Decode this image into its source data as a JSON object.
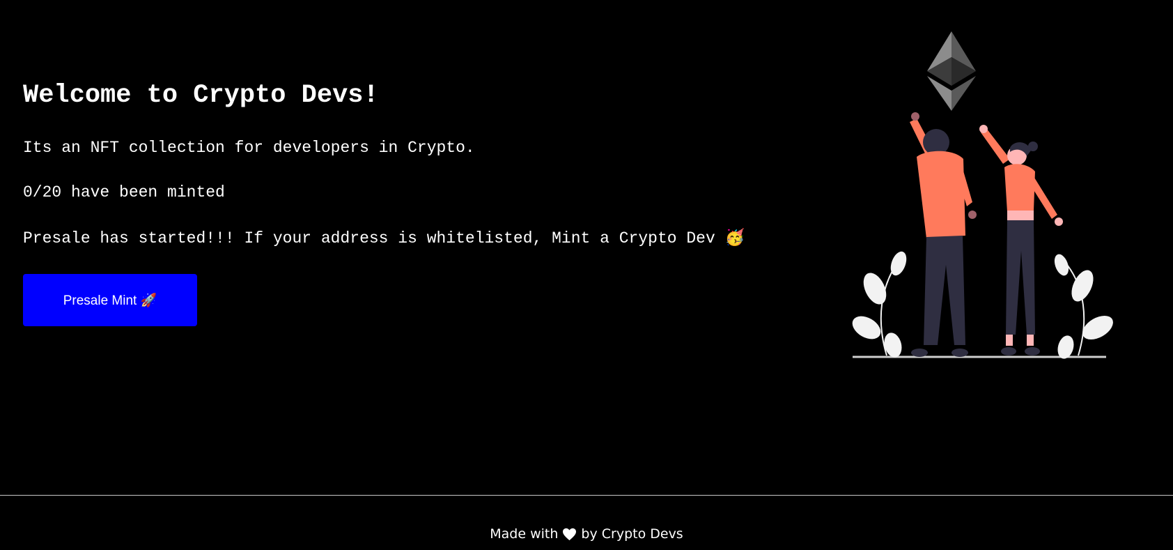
{
  "main": {
    "title": "Welcome to Crypto Devs!",
    "description": "Its an NFT collection for developers in Crypto.",
    "minted_status": "0/20 have been minted",
    "presale_message": "Presale has started!!! If your address is whitelisted, Mint a Crypto Dev 🥳",
    "presale_button_label": "Presale Mint 🚀"
  },
  "illustration": {
    "icon": "ethereum-logo-icon",
    "subject": "two-people-reaching-illustration"
  },
  "footer": {
    "prefix": "Made with",
    "icon": "heart-icon",
    "suffix": "by Crypto Devs"
  },
  "colors": {
    "background": "#000000",
    "text": "#ffffff",
    "button": "#0000ff",
    "accent": "#ff7a5c",
    "dark_clothing": "#2f2e41"
  }
}
